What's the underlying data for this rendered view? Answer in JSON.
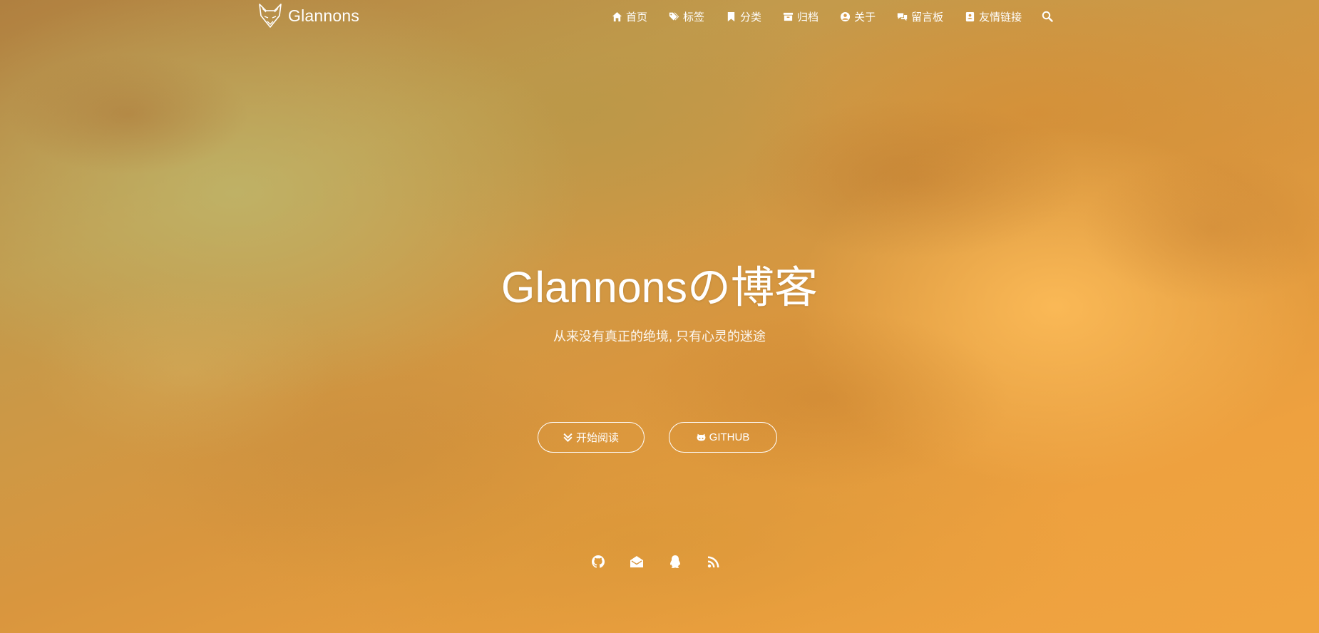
{
  "brand": {
    "title": "Glannons",
    "logo_icon": "fox-logo-icon"
  },
  "nav": {
    "items": [
      {
        "label": "首页",
        "icon": "home-icon"
      },
      {
        "label": "标签",
        "icon": "tags-icon"
      },
      {
        "label": "分类",
        "icon": "bookmark-icon"
      },
      {
        "label": "归档",
        "icon": "archive-icon"
      },
      {
        "label": "关于",
        "icon": "user-circle-icon"
      },
      {
        "label": "留言板",
        "icon": "comments-icon"
      },
      {
        "label": "友情链接",
        "icon": "address-book-icon"
      }
    ],
    "search_icon": "search-icon"
  },
  "hero": {
    "title": "Glannonsの博客",
    "subtitle": "从来没有真正的绝境, 只有心灵的迷途",
    "buttons": {
      "read_label": "开始阅读",
      "github_label": "GITHUB"
    }
  },
  "social": [
    {
      "icon": "github-icon"
    },
    {
      "icon": "envelope-open-icon"
    },
    {
      "icon": "qq-icon"
    },
    {
      "icon": "rss-icon"
    }
  ],
  "colors": {
    "text": "#ffffff",
    "background_warm": "#e79b3c",
    "background_olive": "#b8b06a"
  }
}
